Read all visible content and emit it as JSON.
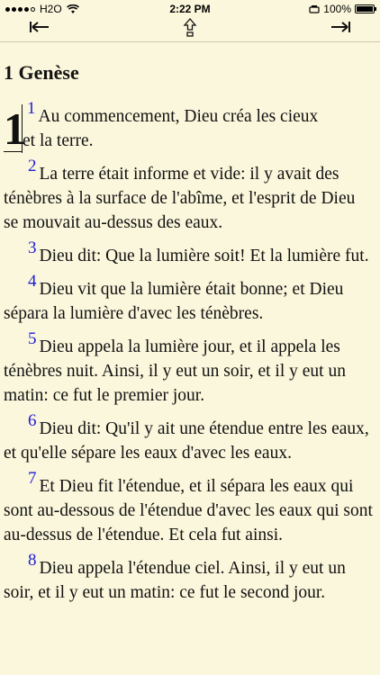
{
  "status_bar": {
    "carrier": "H2O",
    "time": "2:22 PM",
    "battery_percent": "100%",
    "signal_level": 4
  },
  "toolbar": {
    "prev_icon": "arrow-to-left-icon",
    "up_icon": "up-arrow-icon",
    "next_icon": "arrow-to-right-icon"
  },
  "book": {
    "title": "1 Genèse",
    "chapter": "1"
  },
  "verses": [
    {
      "num": "1",
      "line1": "Au commencement, Dieu créa les cieux",
      "line2": "et la terre."
    },
    {
      "num": "2",
      "text": "La terre était informe et vide: il y avait des ténèbres à la surface de l'abîme, et l'esprit de Dieu se mouvait au-dessus des eaux."
    },
    {
      "num": "3",
      "text": "Dieu dit: Que la lumière soit! Et la lumière fut."
    },
    {
      "num": "4",
      "text": "Dieu vit que la lumière était bonne; et Dieu sépara la lumière d'avec les ténèbres."
    },
    {
      "num": "5",
      "text": "Dieu appela la lumière jour, et il appela les ténèbres nuit. Ainsi, il y eut un soir, et il y eut un matin: ce fut le premier jour."
    },
    {
      "num": "6",
      "text": "Dieu dit: Qu'il y ait une étendue entre les eaux, et qu'elle sépare les eaux d'avec les eaux."
    },
    {
      "num": "7",
      "text": "Et Dieu fit l'étendue, et il sépara les eaux qui sont au-dessous de l'étendue d'avec les eaux qui sont au-dessus de l'étendue. Et cela fut ainsi."
    },
    {
      "num": "8",
      "text": "Dieu appela l'étendue ciel. Ainsi, il y eut un soir, et il y eut un matin: ce fut le second jour."
    }
  ]
}
